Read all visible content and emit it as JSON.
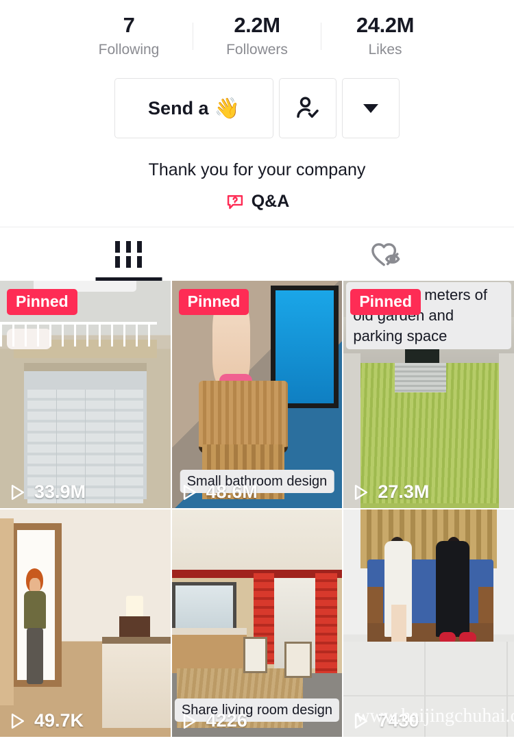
{
  "profile": {
    "stats": [
      {
        "value": "7",
        "label": "Following",
        "name": "following"
      },
      {
        "value": "2.2M",
        "label": "Followers",
        "name": "followers"
      },
      {
        "value": "24.2M",
        "label": "Likes",
        "name": "likes"
      }
    ],
    "buttons": {
      "message_label": "Send a",
      "message_emoji": "👋",
      "follow_icon": "person-check-icon",
      "more_icon": "chevron-down-icon"
    },
    "bio": "Thank you for your company",
    "qa": {
      "label": "Q&A",
      "icon": "question-bubble-icon",
      "icon_color": "#fe2c55"
    }
  },
  "tabs": [
    {
      "name": "posts",
      "icon": "grid-icon",
      "active": true
    },
    {
      "name": "private-liked",
      "icon": "heart-eye-slash-icon",
      "active": false
    }
  ],
  "videos": [
    {
      "name": "video-loft-bedroom",
      "pinned_label": "Pinned",
      "views": "33.9M",
      "caption": "",
      "play_icon": "play-triangle-icon"
    },
    {
      "name": "video-small-bathroom",
      "pinned_label": "Pinned",
      "views": "48.6M",
      "caption": "Small bathroom design",
      "play_icon": "play-triangle-icon"
    },
    {
      "name": "video-garden-parking",
      "pinned_label": "Pinned",
      "views": "27.3M",
      "caption": "50 square meters of old garden and parking space",
      "play_icon": "play-triangle-icon"
    },
    {
      "name": "video-3d-bedroom",
      "pinned_label": "",
      "views": "49.7K",
      "caption": "",
      "play_icon": "play-triangle-icon"
    },
    {
      "name": "video-living-room",
      "pinned_label": "",
      "views": "4226",
      "caption": "Share living room design",
      "play_icon": "play-triangle-icon"
    },
    {
      "name": "video-sofa-couple",
      "pinned_label": "",
      "views": "7430",
      "caption": "",
      "watermark": "www.haijingchuhai.com",
      "play_icon": "play-triangle-icon"
    }
  ],
  "colors": {
    "accent": "#fe2c55",
    "text": "#161823",
    "muted": "#8a8b91",
    "border": "#e3e3e4"
  }
}
